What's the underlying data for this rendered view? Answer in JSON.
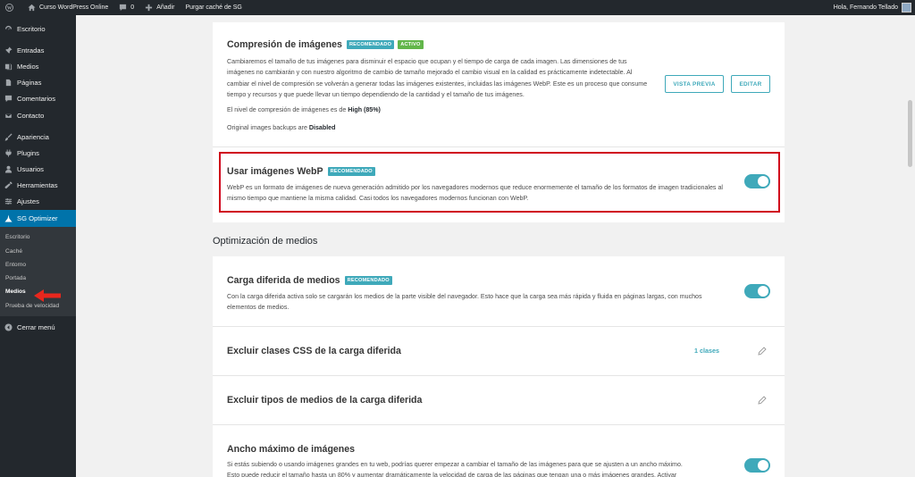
{
  "adminbar": {
    "site_name": "Curso WordPress Online",
    "comments_count": "0",
    "add_new": "Añadir",
    "purge_cache": "Purgar caché de SG",
    "greeting": "Hola, Fernando Tellado"
  },
  "sidebar": {
    "items": [
      {
        "label": "Escritorio",
        "icon": "dashboard-icon"
      },
      {
        "label": "Entradas",
        "icon": "pin-icon"
      },
      {
        "label": "Medios",
        "icon": "media-icon"
      },
      {
        "label": "Páginas",
        "icon": "pages-icon"
      },
      {
        "label": "Comentarios",
        "icon": "comment-icon"
      },
      {
        "label": "Contacto",
        "icon": "mail-icon"
      },
      {
        "label": "Apariencia",
        "icon": "brush-icon"
      },
      {
        "label": "Plugins",
        "icon": "plugin-icon"
      },
      {
        "label": "Usuarios",
        "icon": "user-icon"
      },
      {
        "label": "Herramientas",
        "icon": "wrench-icon"
      },
      {
        "label": "Ajustes",
        "icon": "settings-icon"
      },
      {
        "label": "SG Optimizer",
        "icon": "sg-icon"
      }
    ],
    "submenu": [
      "Escritorio",
      "Caché",
      "Entorno",
      "Portada",
      "Medios",
      "Prueba de velocidad"
    ],
    "collapse": "Cerrar menú"
  },
  "image_compression": {
    "title": "Compresión de imágenes",
    "badge_recommended": "RECOMENDADO",
    "badge_active": "ACTIVO",
    "description": "Cambiaremos el tamaño de tus imágenes para disminuir el espacio que ocupan y el tiempo de carga de cada imagen. Las dimensiones de tus imágenes no cambiarán y con nuestro algoritmo de cambio de tamaño mejorado el cambio visual en la calidad es prácticamente indetectable. Al cambiar el nivel de compresión se volverán a generar todas las imágenes existentes, incluidas las imágenes WebP. Este es un proceso que consume tiempo y recursos y que puede llevar un tiempo dependiendo de la cantidad y el tamaño de tus imágenes.",
    "level_prefix": "El nivel de compresión de imágenes es de ",
    "level_value": "High (85%)",
    "backups_prefix": "Original images backups are ",
    "backups_value": "Disabled",
    "preview_button": "VISTA PREVIA",
    "edit_button": "EDITAR"
  },
  "webp": {
    "title": "Usar imágenes WebP",
    "badge": "RECOMENDADO",
    "description": "WebP es un formato de imágenes de nueva generación admitido por los navegadores modernos que reduce enormemente el tamaño de los formatos de imagen tradicionales al mismo tiempo que mantiene la misma calidad. Casi todos los navegadores modernos funcionan con WebP.",
    "enabled": true
  },
  "media_heading": "Optimización de medios",
  "lazy_load": {
    "title": "Carga diferida de medios",
    "badge": "RECOMENDADO",
    "description": "Con la carga diferida activa solo se cargarán los medios de la parte visible del navegador. Esto hace que la carga sea más rápida y fluida en páginas largas, con muchos elementos de medios.",
    "enabled": true
  },
  "exclude_css": {
    "title": "Excluir clases CSS de la carga diferida",
    "link": "1 clases"
  },
  "exclude_media": {
    "title": "Excluir tipos de medios de la carga diferida"
  },
  "max_width": {
    "title": "Ancho máximo de imágenes",
    "description_line1": "Si estás subiendo o usando imágenes grandes en tu web, podrías querer empezar a cambiar el tamaño de las imágenes para que se ajusten a un ancho máximo.",
    "description_line2": "Esto puede reducir el tamaño hasta un 80% y aumentar dramáticamente la velocidad de carga de las páginas que tengan una o más imágenes grandes. Activar",
    "enabled": true
  },
  "colors": {
    "accent": "#3fa9ba",
    "active_badge": "#62b64a",
    "highlight": "#d0021b",
    "sidebar": "#23282d",
    "sidebar_active": "#0073aa"
  }
}
